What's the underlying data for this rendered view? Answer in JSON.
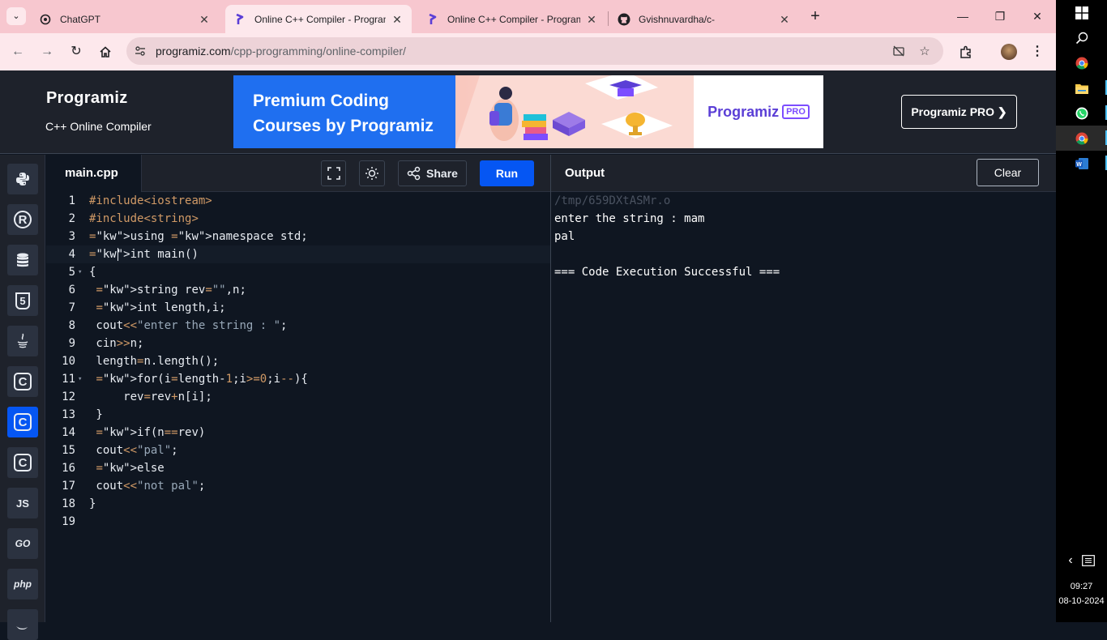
{
  "browser": {
    "tabs": [
      {
        "title": "ChatGPT",
        "icon": "chatgpt-icon",
        "active": false
      },
      {
        "title": "Online C++ Compiler - Program",
        "icon": "programiz-icon",
        "active": true
      },
      {
        "title": "Online C++ Compiler - Program",
        "icon": "programiz-icon",
        "active": false
      },
      {
        "title": "Gvishnuvardha/c-",
        "icon": "github-icon",
        "active": false
      }
    ],
    "new_tab": "+",
    "url_host": "programiz.com",
    "url_path": "/cpp-programming/online-compiler/",
    "colors": {
      "tabbar": "#f7c7cf",
      "toolbar": "#fde8ec"
    }
  },
  "site": {
    "logo": "Programiz",
    "subtitle": "C++ Online Compiler",
    "banner": {
      "line1": "Premium Coding",
      "line2": "Courses by Programiz",
      "brand": "Programiz",
      "badge": "PRO"
    },
    "pro_button": "Programiz PRO ❯"
  },
  "languages": [
    {
      "name": "python-icon",
      "label": "",
      "active": false
    },
    {
      "name": "r-icon",
      "label": "R",
      "active": false
    },
    {
      "name": "sql-icon",
      "label": "",
      "active": false
    },
    {
      "name": "html-icon",
      "label": "5",
      "active": false
    },
    {
      "name": "java-icon",
      "label": "",
      "active": false
    },
    {
      "name": "c-icon",
      "label": "C",
      "active": false
    },
    {
      "name": "cpp-icon",
      "label": "C",
      "active": true
    },
    {
      "name": "csharp-icon",
      "label": "C",
      "active": false
    },
    {
      "name": "javascript-icon",
      "label": "JS",
      "active": false
    },
    {
      "name": "go-icon",
      "label": "GO",
      "active": false
    },
    {
      "name": "php-icon",
      "label": "php",
      "active": false
    },
    {
      "name": "swift-icon",
      "label": "",
      "active": false
    }
  ],
  "editor": {
    "file_name": "main.cpp",
    "share_label": "Share",
    "run_label": "Run",
    "lines": [
      "#include<iostream>",
      "#include<string>",
      "using namespace std;",
      "int main()",
      "{",
      " string rev=\"\",n;",
      " int length,i;",
      " cout<<\"enter the string : \";",
      " cin>>n;",
      " length=n.length();",
      " for(i=length-1;i>=0;i--){",
      "     rev=rev+n[i];",
      " }",
      " if(n==rev)",
      " cout<<\"pal\";",
      " else",
      " cout<<\"not pal\";",
      "}",
      ""
    ],
    "fold_lines": [
      5,
      11
    ],
    "current_line": 4
  },
  "output": {
    "title": "Output",
    "clear_label": "Clear",
    "lines": [
      "/tmp/659DXtASMr.o",
      "enter the string : mam",
      "pal",
      "",
      "=== Code Execution Successful ==="
    ]
  },
  "taskbar": {
    "time": "09:27",
    "date": "08-10-2024"
  }
}
